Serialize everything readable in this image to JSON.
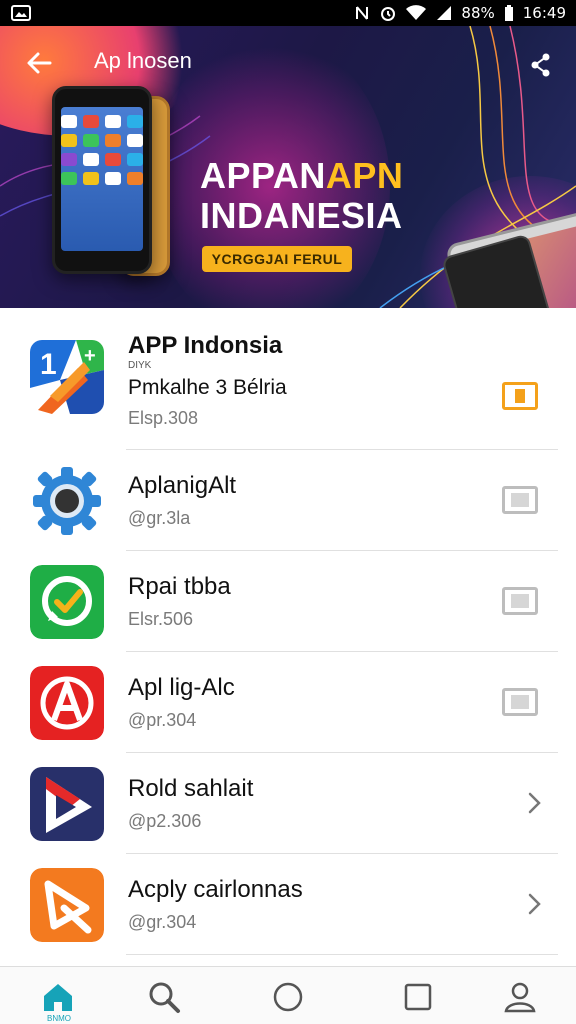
{
  "status_bar": {
    "icons": [
      "gallery-icon",
      "nfc-icon",
      "alarm-icon",
      "wifi-icon",
      "signal-icon",
      "battery-icon"
    ],
    "battery": "88%",
    "time": "16:49"
  },
  "banner": {
    "title": "Ap lnosen",
    "headline_line1_a": "APPAN",
    "headline_line1_b": "APN",
    "headline_line2": "INDANESIA",
    "tag_button": "YCRGGJAI FERUL",
    "colors": {
      "accent": "#ffbf1f",
      "tag_bg": "#f7b21d"
    }
  },
  "apps": [
    {
      "name": "APP Indonsia",
      "subtitle": "DIYK",
      "subtitle2": "Pmkalhe 3 Bélria",
      "size": "Elsp.308",
      "control": "checkbox",
      "checked": true
    },
    {
      "name": "AplanigAlt",
      "size": "@gr.3la",
      "control": "checkbox",
      "checked": false
    },
    {
      "name": "Rpai tbba",
      "size": "Elsr.506",
      "control": "checkbox",
      "checked": false
    },
    {
      "name": "Apl lig-Alc",
      "size": "@pr.304",
      "control": "checkbox",
      "checked": false
    },
    {
      "name": "Rold sahlait",
      "size": "@p2.306",
      "control": "chevron",
      "checked": false
    },
    {
      "name": "Acply cairlonnas",
      "size": "@gr.304",
      "control": "chevron",
      "checked": false
    }
  ],
  "bottom_nav": {
    "items": [
      "home-icon",
      "search-icon",
      "circle-icon",
      "square-icon",
      "profile-icon"
    ],
    "home_label": "BNMO"
  },
  "colors": {
    "checked": "#f4a11a",
    "unchecked": "#bdbdbd",
    "nav_active": "#16a3b8"
  }
}
